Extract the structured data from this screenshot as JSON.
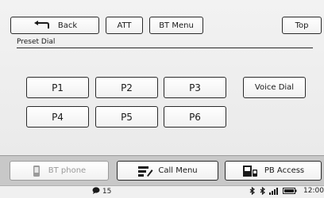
{
  "top_bar": {
    "back_label": "Back",
    "att_label": "ATT",
    "bt_menu_label": "BT Menu",
    "top_label": "Top"
  },
  "section": {
    "title": "Preset Dial"
  },
  "presets": [
    {
      "label": "P1"
    },
    {
      "label": "P2"
    },
    {
      "label": "P3"
    },
    {
      "label": "P4"
    },
    {
      "label": "P5"
    },
    {
      "label": "P6"
    }
  ],
  "voice_dial_label": "Voice Dial",
  "bottom_bar": {
    "bt_phone_label": "BT phone",
    "call_menu_label": "Call Menu",
    "pb_access_label": "PB Access"
  },
  "status": {
    "message_count": "15",
    "time": "12:00"
  },
  "icons": {
    "back": "back-arrow-icon",
    "phone": "phone-icon",
    "call_menu": "call-menu-icon",
    "pb_access": "phonebook-icon",
    "message": "message-bubble-icon",
    "bluetooth": "bluetooth-icon",
    "signal": "signal-icon",
    "battery": "battery-icon"
  },
  "colors": {
    "screen_bg": "#eeeeee",
    "border": "#2a2a2a",
    "disabled_text": "#9a9a9a",
    "bottom_panel": "#c8c8c8"
  }
}
